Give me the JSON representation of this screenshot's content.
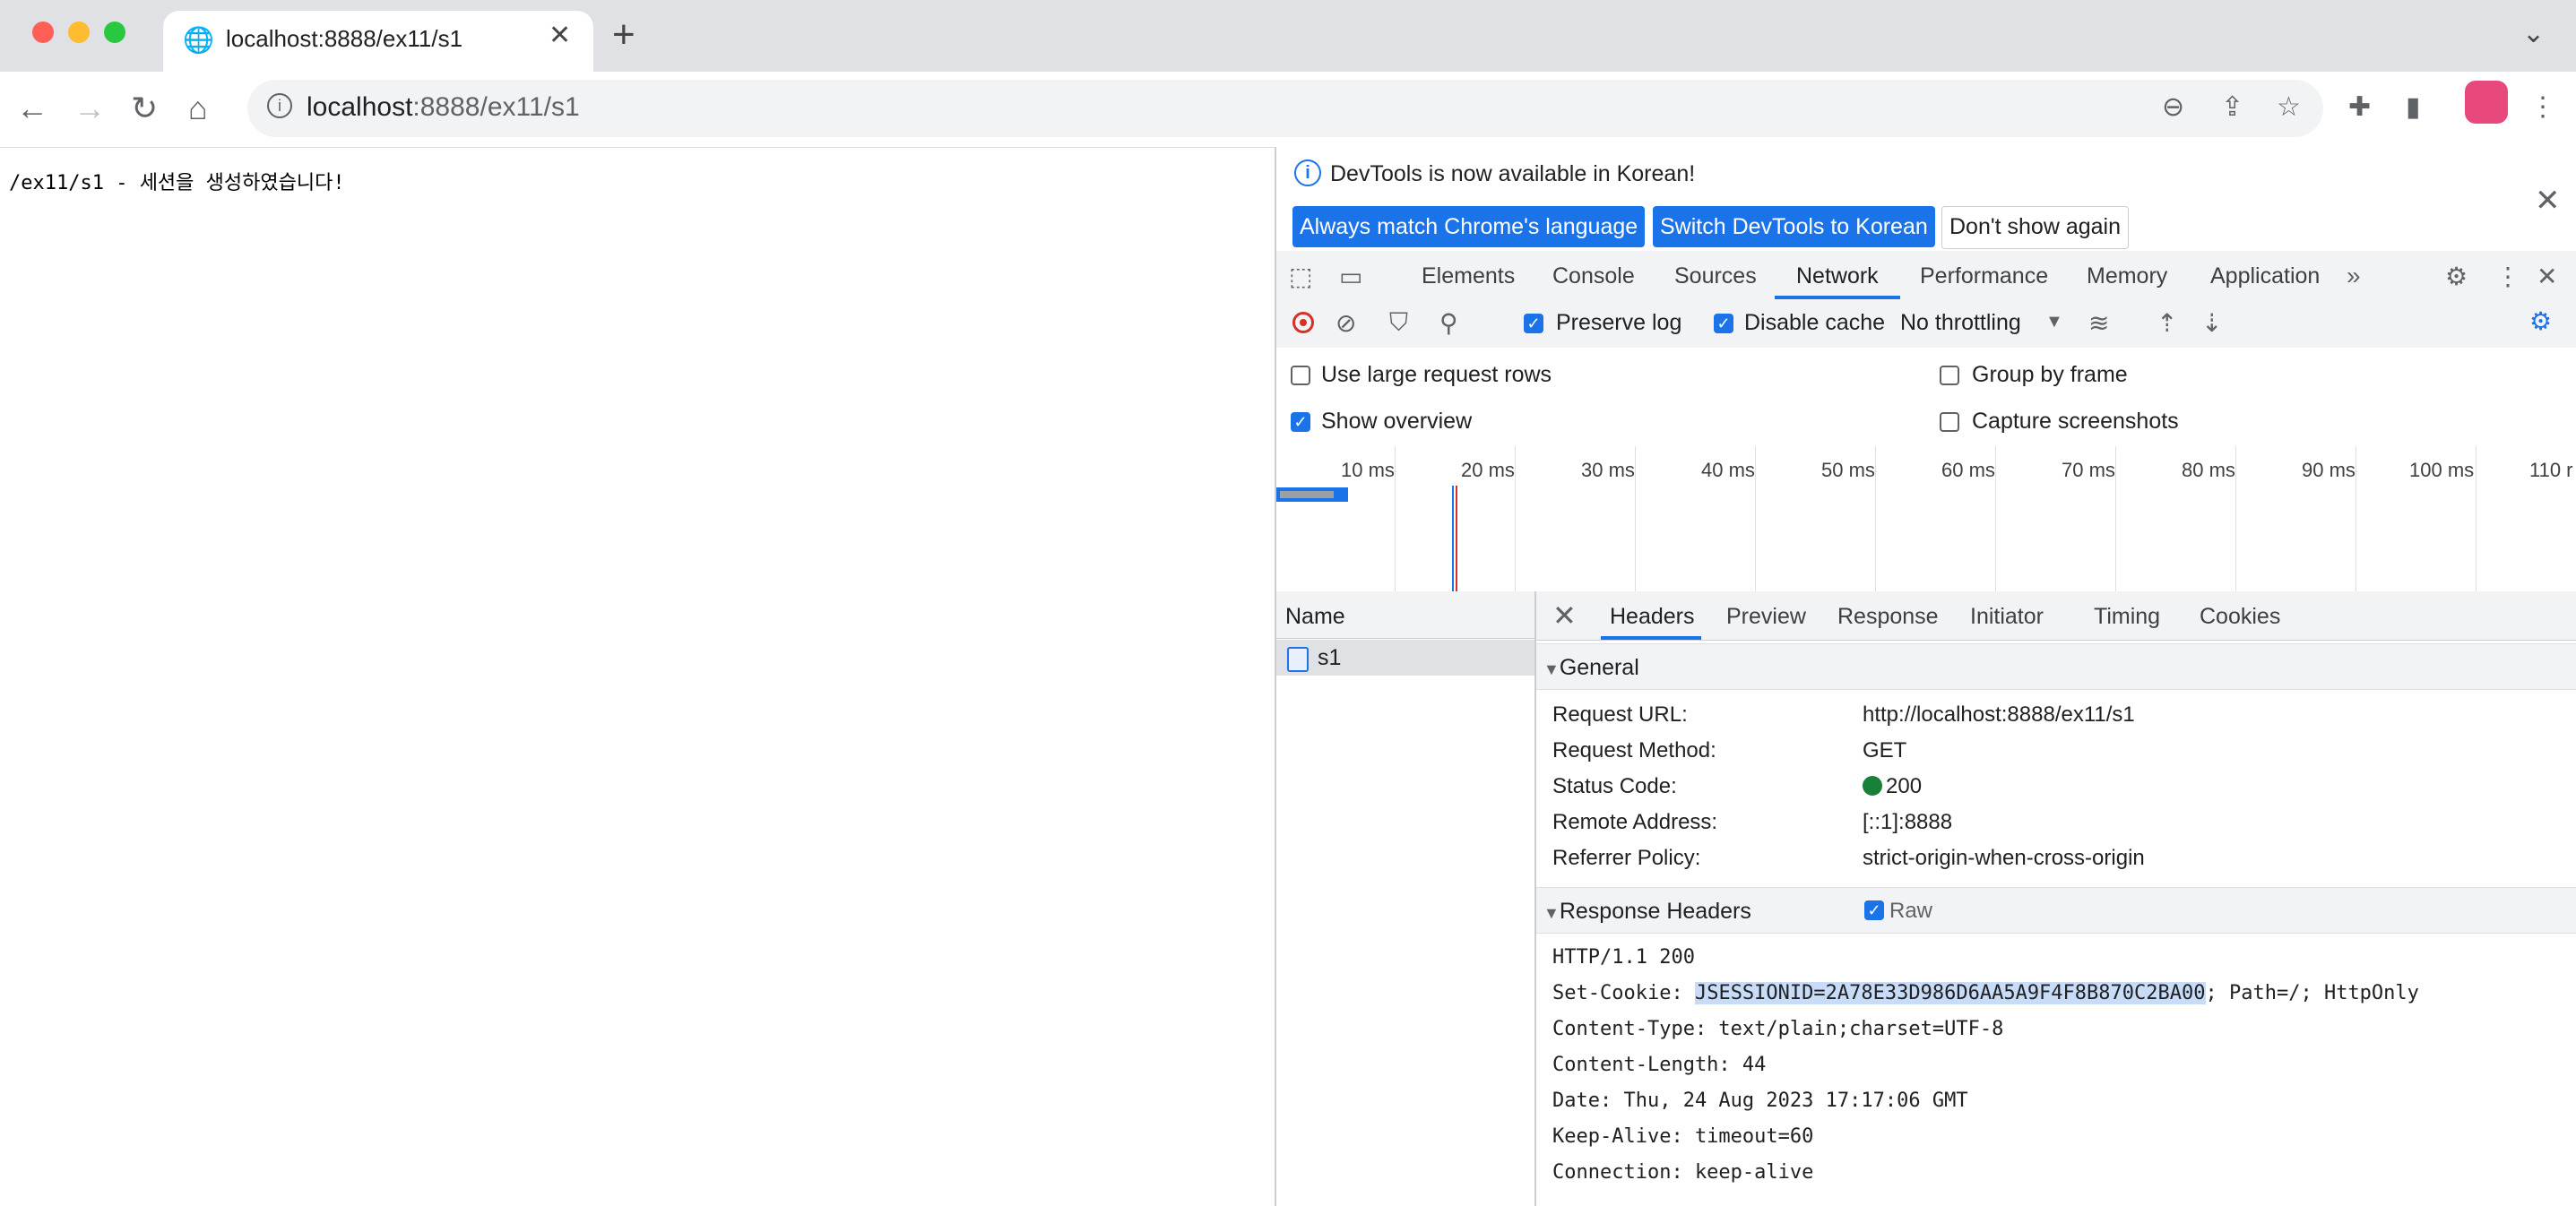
{
  "browser": {
    "tab_title": "localhost:8888/ex11/s1",
    "url_host": "localhost",
    "url_rest": ":8888/ex11/s1",
    "colors": {
      "close": "#ff5f57",
      "minimize": "#febc2e",
      "maximize": "#28c840",
      "profile": "#e8497c"
    }
  },
  "page": {
    "text": "/ex11/s1 - 세션을 생성하였습니다!"
  },
  "devtools": {
    "notice": {
      "message": "DevTools is now available in Korean!",
      "btn_match": "Always match Chrome's language",
      "btn_switch": "Switch DevTools to Korean",
      "btn_dont_show": "Don't show again"
    },
    "tabs": [
      "Elements",
      "Console",
      "Sources",
      "Network",
      "Performance",
      "Memory",
      "Application"
    ],
    "active_tab": "Network",
    "toolbar": {
      "preserve_log": "Preserve log",
      "disable_cache": "Disable cache",
      "throttling": "No throttling"
    },
    "settings": {
      "large_rows": "Use large request rows",
      "group_by_frame": "Group by frame",
      "show_overview": "Show overview",
      "capture_screenshots": "Capture screenshots"
    },
    "overview_ticks": [
      "10 ms",
      "20 ms",
      "30 ms",
      "40 ms",
      "50 ms",
      "60 ms",
      "70 ms",
      "80 ms",
      "90 ms",
      "100 ms",
      "110 r"
    ],
    "requests": {
      "name_header": "Name",
      "rows": [
        "s1"
      ]
    },
    "details": {
      "tabs": [
        "Headers",
        "Preview",
        "Response",
        "Initiator",
        "Timing",
        "Cookies"
      ],
      "general_title": "General",
      "general": [
        {
          "key": "Request URL:",
          "value": "http://localhost:8888/ex11/s1"
        },
        {
          "key": "Request Method:",
          "value": "GET"
        },
        {
          "key": "Status Code:",
          "value": "200"
        },
        {
          "key": "Remote Address:",
          "value": "[::1]:8888"
        },
        {
          "key": "Referrer Policy:",
          "value": "strict-origin-when-cross-origin"
        }
      ],
      "response_title": "Response Headers",
      "raw_label": "Raw",
      "raw_lines": [
        "HTTP/1.1 200",
        "Set-Cookie: ",
        "Content-Type: text/plain;charset=UTF-8",
        "Content-Length: 44",
        "Date: Thu, 24 Aug 2023 17:17:06 GMT",
        "Keep-Alive: timeout=60",
        "Connection: keep-alive"
      ],
      "cookie_highlight": "JSESSIONID=2A78E33D986D6AA5A9F4F8B870C2BA00",
      "cookie_rest": "; Path=/; HttpOnly"
    }
  }
}
